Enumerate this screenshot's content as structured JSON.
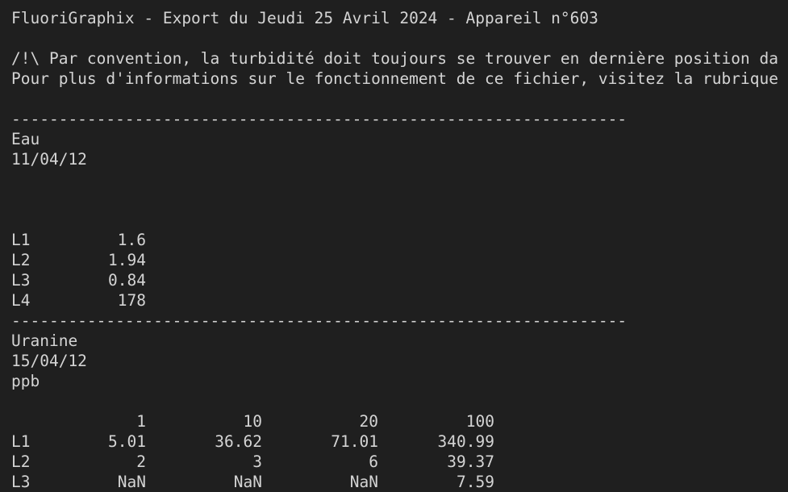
{
  "header": {
    "title": "FluoriGraphix - Export du Jeudi 25 Avril 2024 - Appareil n°603",
    "note_line1": "/!\\ Par convention, la turbidité doit toujours se trouver en dernière position da",
    "note_line2": "Pour plus d'informations sur le fonctionnement de ce fichier, visitez la rubrique"
  },
  "separator": "-----------------------------------------------------------------",
  "sections": [
    {
      "name": "Eau",
      "date": "11/04/12",
      "unit": "",
      "rows": [
        {
          "label": "L1",
          "value": "1.6"
        },
        {
          "label": "L2",
          "value": "1.94"
        },
        {
          "label": "L3",
          "value": "0.84"
        },
        {
          "label": "L4",
          "value": "178"
        }
      ]
    },
    {
      "name": "Uranine",
      "date": "15/04/12",
      "unit": "ppb",
      "columns": [
        "1",
        "10",
        "20",
        "100"
      ],
      "rows": [
        {
          "label": "L1",
          "values": [
            "5.01",
            "36.62",
            "71.01",
            "340.99"
          ]
        },
        {
          "label": "L2",
          "values": [
            "2",
            "3",
            "6",
            "39.37"
          ]
        },
        {
          "label": "L3",
          "values": [
            "NaN",
            "NaN",
            "NaN",
            "7.59"
          ]
        }
      ]
    }
  ]
}
